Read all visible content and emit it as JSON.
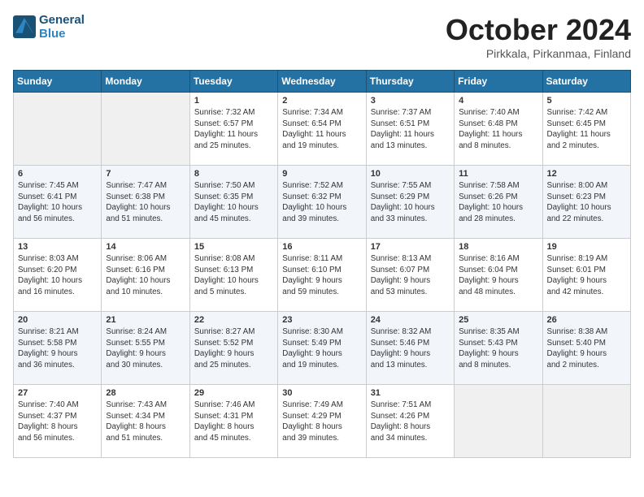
{
  "header": {
    "logo_line1": "General",
    "logo_line2": "Blue",
    "month": "October 2024",
    "location": "Pirkkala, Pirkanmaa, Finland"
  },
  "weekdays": [
    "Sunday",
    "Monday",
    "Tuesday",
    "Wednesday",
    "Thursday",
    "Friday",
    "Saturday"
  ],
  "weeks": [
    [
      {
        "day": "",
        "info": ""
      },
      {
        "day": "",
        "info": ""
      },
      {
        "day": "1",
        "info": "Sunrise: 7:32 AM\nSunset: 6:57 PM\nDaylight: 11 hours\nand 25 minutes."
      },
      {
        "day": "2",
        "info": "Sunrise: 7:34 AM\nSunset: 6:54 PM\nDaylight: 11 hours\nand 19 minutes."
      },
      {
        "day": "3",
        "info": "Sunrise: 7:37 AM\nSunset: 6:51 PM\nDaylight: 11 hours\nand 13 minutes."
      },
      {
        "day": "4",
        "info": "Sunrise: 7:40 AM\nSunset: 6:48 PM\nDaylight: 11 hours\nand 8 minutes."
      },
      {
        "day": "5",
        "info": "Sunrise: 7:42 AM\nSunset: 6:45 PM\nDaylight: 11 hours\nand 2 minutes."
      }
    ],
    [
      {
        "day": "6",
        "info": "Sunrise: 7:45 AM\nSunset: 6:41 PM\nDaylight: 10 hours\nand 56 minutes."
      },
      {
        "day": "7",
        "info": "Sunrise: 7:47 AM\nSunset: 6:38 PM\nDaylight: 10 hours\nand 51 minutes."
      },
      {
        "day": "8",
        "info": "Sunrise: 7:50 AM\nSunset: 6:35 PM\nDaylight: 10 hours\nand 45 minutes."
      },
      {
        "day": "9",
        "info": "Sunrise: 7:52 AM\nSunset: 6:32 PM\nDaylight: 10 hours\nand 39 minutes."
      },
      {
        "day": "10",
        "info": "Sunrise: 7:55 AM\nSunset: 6:29 PM\nDaylight: 10 hours\nand 33 minutes."
      },
      {
        "day": "11",
        "info": "Sunrise: 7:58 AM\nSunset: 6:26 PM\nDaylight: 10 hours\nand 28 minutes."
      },
      {
        "day": "12",
        "info": "Sunrise: 8:00 AM\nSunset: 6:23 PM\nDaylight: 10 hours\nand 22 minutes."
      }
    ],
    [
      {
        "day": "13",
        "info": "Sunrise: 8:03 AM\nSunset: 6:20 PM\nDaylight: 10 hours\nand 16 minutes."
      },
      {
        "day": "14",
        "info": "Sunrise: 8:06 AM\nSunset: 6:16 PM\nDaylight: 10 hours\nand 10 minutes."
      },
      {
        "day": "15",
        "info": "Sunrise: 8:08 AM\nSunset: 6:13 PM\nDaylight: 10 hours\nand 5 minutes."
      },
      {
        "day": "16",
        "info": "Sunrise: 8:11 AM\nSunset: 6:10 PM\nDaylight: 9 hours\nand 59 minutes."
      },
      {
        "day": "17",
        "info": "Sunrise: 8:13 AM\nSunset: 6:07 PM\nDaylight: 9 hours\nand 53 minutes."
      },
      {
        "day": "18",
        "info": "Sunrise: 8:16 AM\nSunset: 6:04 PM\nDaylight: 9 hours\nand 48 minutes."
      },
      {
        "day": "19",
        "info": "Sunrise: 8:19 AM\nSunset: 6:01 PM\nDaylight: 9 hours\nand 42 minutes."
      }
    ],
    [
      {
        "day": "20",
        "info": "Sunrise: 8:21 AM\nSunset: 5:58 PM\nDaylight: 9 hours\nand 36 minutes."
      },
      {
        "day": "21",
        "info": "Sunrise: 8:24 AM\nSunset: 5:55 PM\nDaylight: 9 hours\nand 30 minutes."
      },
      {
        "day": "22",
        "info": "Sunrise: 8:27 AM\nSunset: 5:52 PM\nDaylight: 9 hours\nand 25 minutes."
      },
      {
        "day": "23",
        "info": "Sunrise: 8:30 AM\nSunset: 5:49 PM\nDaylight: 9 hours\nand 19 minutes."
      },
      {
        "day": "24",
        "info": "Sunrise: 8:32 AM\nSunset: 5:46 PM\nDaylight: 9 hours\nand 13 minutes."
      },
      {
        "day": "25",
        "info": "Sunrise: 8:35 AM\nSunset: 5:43 PM\nDaylight: 9 hours\nand 8 minutes."
      },
      {
        "day": "26",
        "info": "Sunrise: 8:38 AM\nSunset: 5:40 PM\nDaylight: 9 hours\nand 2 minutes."
      }
    ],
    [
      {
        "day": "27",
        "info": "Sunrise: 7:40 AM\nSunset: 4:37 PM\nDaylight: 8 hours\nand 56 minutes."
      },
      {
        "day": "28",
        "info": "Sunrise: 7:43 AM\nSunset: 4:34 PM\nDaylight: 8 hours\nand 51 minutes."
      },
      {
        "day": "29",
        "info": "Sunrise: 7:46 AM\nSunset: 4:31 PM\nDaylight: 8 hours\nand 45 minutes."
      },
      {
        "day": "30",
        "info": "Sunrise: 7:49 AM\nSunset: 4:29 PM\nDaylight: 8 hours\nand 39 minutes."
      },
      {
        "day": "31",
        "info": "Sunrise: 7:51 AM\nSunset: 4:26 PM\nDaylight: 8 hours\nand 34 minutes."
      },
      {
        "day": "",
        "info": ""
      },
      {
        "day": "",
        "info": ""
      }
    ]
  ]
}
